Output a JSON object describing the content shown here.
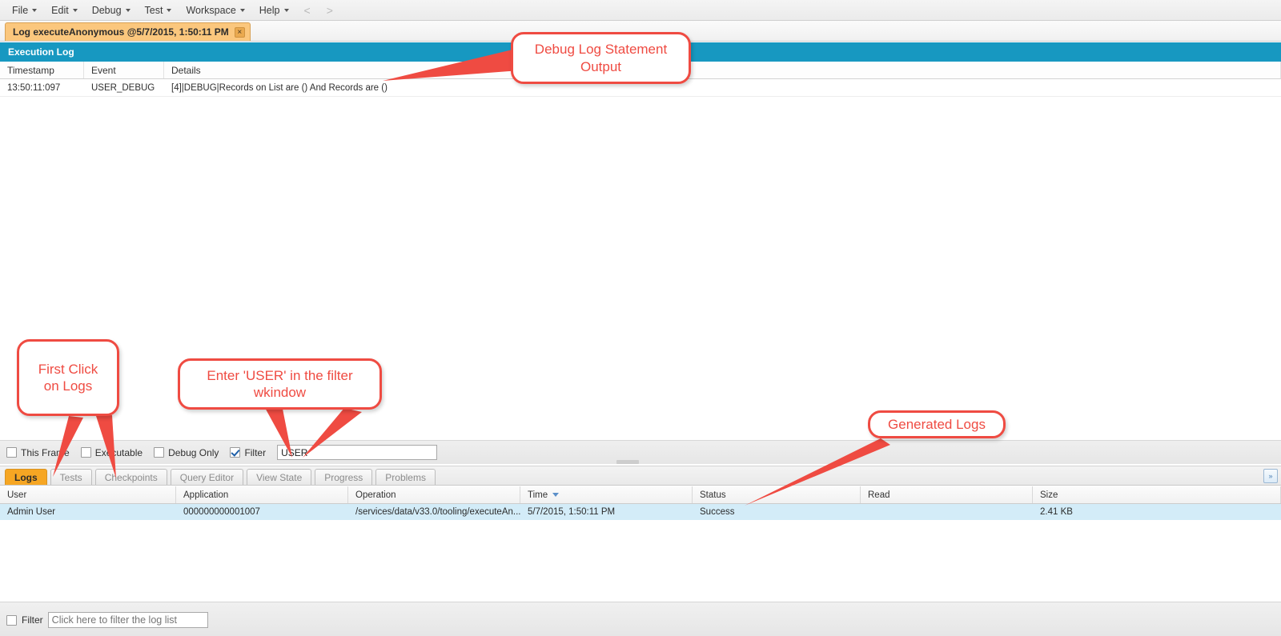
{
  "menubar": {
    "items": [
      {
        "label": "File",
        "has_caret": true
      },
      {
        "label": "Edit",
        "has_caret": true
      },
      {
        "label": "Debug",
        "has_caret": true
      },
      {
        "label": "Test",
        "has_caret": true
      },
      {
        "label": "Workspace",
        "has_caret": true
      },
      {
        "label": "Help",
        "has_caret": true
      }
    ],
    "nav_back": "<",
    "nav_forward": ">"
  },
  "document_tab": {
    "label": "Log executeAnonymous @5/7/2015, 1:50:11 PM",
    "close_glyph": "×"
  },
  "execution_log": {
    "title": "Execution Log",
    "columns": [
      "Timestamp",
      "Event",
      "Details"
    ],
    "rows": [
      {
        "timestamp": "13:50:11:097",
        "event": "USER_DEBUG",
        "details": "[4]|DEBUG|Records on List are () And Records are ()"
      }
    ]
  },
  "options_bar": {
    "checkboxes": [
      {
        "label": "This Frame",
        "checked": false
      },
      {
        "label": "Executable",
        "checked": false
      },
      {
        "label": "Debug Only",
        "checked": false
      },
      {
        "label": "Filter",
        "checked": true
      }
    ],
    "filter_value": "USER",
    "filter_placeholder": ""
  },
  "panel_tabs": {
    "items": [
      {
        "label": "Logs",
        "active": true
      },
      {
        "label": "Tests",
        "active": false
      },
      {
        "label": "Checkpoints",
        "active": false
      },
      {
        "label": "Query Editor",
        "active": false
      },
      {
        "label": "View State",
        "active": false
      },
      {
        "label": "Progress",
        "active": false
      },
      {
        "label": "Problems",
        "active": false
      }
    ],
    "expand_glyph": "»"
  },
  "log_list": {
    "columns": [
      {
        "label": "User",
        "sorted": false
      },
      {
        "label": "Application",
        "sorted": false
      },
      {
        "label": "Operation",
        "sorted": false
      },
      {
        "label": "Time",
        "sorted": true
      },
      {
        "label": "Status",
        "sorted": false
      },
      {
        "label": "Read",
        "sorted": false
      },
      {
        "label": "Size",
        "sorted": false
      }
    ],
    "rows": [
      {
        "user": "Admin User",
        "application": "000000000001007",
        "operation": "/services/data/v33.0/tooling/executeAn...",
        "time": "5/7/2015, 1:50:11 PM",
        "status": "Success",
        "read": "",
        "size": "2.41 KB"
      }
    ]
  },
  "bottom_bar": {
    "filter_checkbox_label": "Filter",
    "filter_checked": false,
    "filter_value": "",
    "filter_placeholder": "Click here to filter the log list"
  },
  "annotations": [
    {
      "id": "debug-output",
      "text": "Debug Log Statement Output"
    },
    {
      "id": "first-click-logs",
      "text": "First Click on Logs"
    },
    {
      "id": "enter-user-filter",
      "text": "Enter 'USER' in the filter wkindow"
    },
    {
      "id": "generated-logs",
      "text": "Generated Logs"
    }
  ],
  "colors": {
    "accent_blue": "#1798c1",
    "tab_orange": "#f6a623",
    "annotation_red": "#ef4b42",
    "row_highlight": "#d3ecf8"
  }
}
